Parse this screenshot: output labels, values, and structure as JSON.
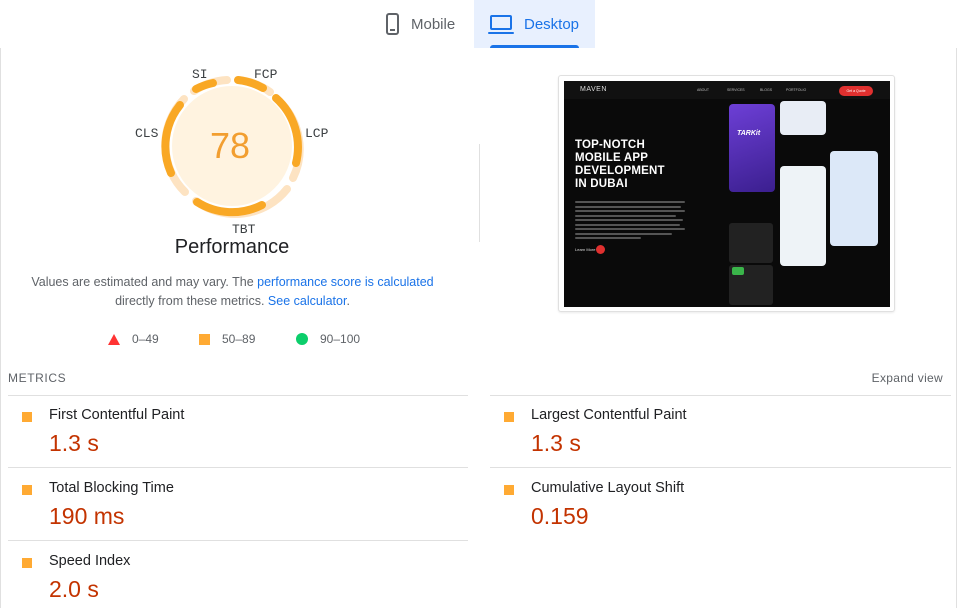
{
  "tabs": {
    "mobile_label": "Mobile",
    "desktop_label": "Desktop",
    "active": "Desktop"
  },
  "gauge": {
    "score": "78",
    "score_fraction": 0.78,
    "title": "Performance",
    "segment_labels": {
      "si": "SI",
      "fcp": "FCP",
      "lcp": "LCP",
      "tbt": "TBT",
      "cls": "CLS"
    },
    "color": "#f29e30"
  },
  "description": {
    "text_1": "Values are estimated and may vary. The ",
    "link_1": "performance score is calculated",
    "text_2": " directly from these metrics. ",
    "link_2": "See calculator",
    "text_3": "."
  },
  "legend": {
    "fail": "0–49",
    "average": "50–89",
    "pass": "90–100",
    "colors": {
      "fail": "#ff3333",
      "average": "#ffaa33",
      "pass": "#0cce6b"
    }
  },
  "preview": {
    "logo": "MAVEN",
    "nav": [
      "ABOUT",
      "SERVICES",
      "BLOGS",
      "PORTFOLIO"
    ],
    "cta": "Get a Quote",
    "headline": [
      "TOP-NOTCH",
      "MOBILE APP",
      "DEVELOPMENT",
      "IN DUBAI"
    ],
    "learn_more": "Learn More",
    "card_brand": "TARKit"
  },
  "metrics": {
    "header": "METRICS",
    "expand_label": "Expand view",
    "items": [
      {
        "name": "First Contentful Paint",
        "value": "1.3 s"
      },
      {
        "name": "Largest Contentful Paint",
        "value": "1.3 s"
      },
      {
        "name": "Total Blocking Time",
        "value": "190 ms"
      },
      {
        "name": "Cumulative Layout Shift",
        "value": "0.159"
      },
      {
        "name": "Speed Index",
        "value": "2.0 s"
      }
    ],
    "value_color": "#c33300"
  }
}
